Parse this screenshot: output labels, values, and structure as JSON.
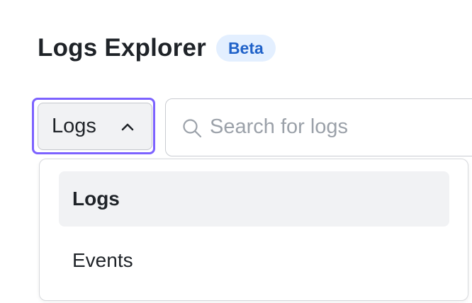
{
  "header": {
    "title": "Logs Explorer",
    "badge": "Beta"
  },
  "selector": {
    "value": "Logs",
    "icon": "chevron-up-icon",
    "focus_color": "#7c62ff"
  },
  "search": {
    "placeholder": "Search for logs",
    "value": "",
    "icon": "search-icon"
  },
  "dropdown": {
    "items": [
      {
        "label": "Logs",
        "selected": true
      },
      {
        "label": "Events",
        "selected": false
      }
    ]
  },
  "colors": {
    "badge_bg": "#e3efff",
    "badge_text": "#2062c9",
    "selected_item_bg": "#f1f2f4"
  }
}
